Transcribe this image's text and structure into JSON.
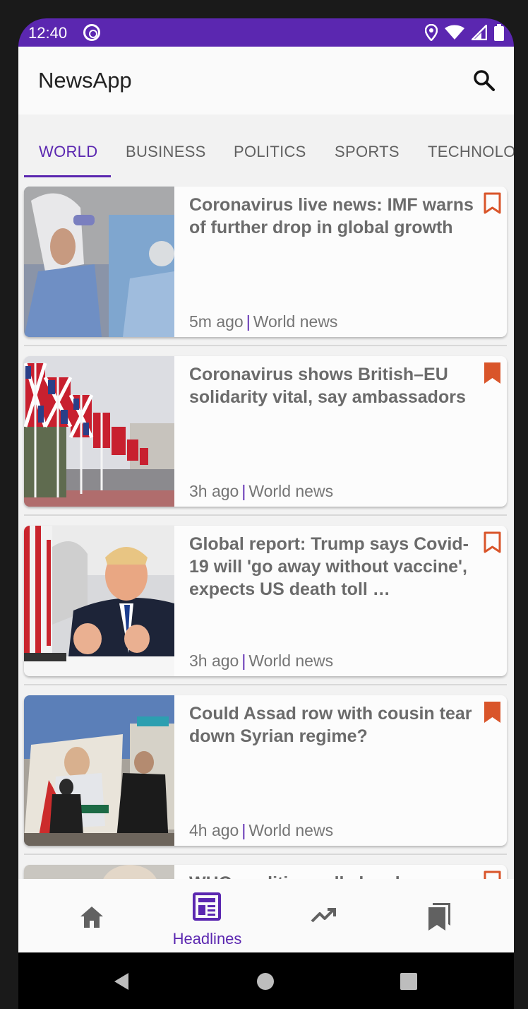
{
  "status_bar": {
    "time": "12:40"
  },
  "app_bar": {
    "title": "NewsApp"
  },
  "tabs": [
    {
      "label": "WORLD",
      "active": true
    },
    {
      "label": "BUSINESS",
      "active": false
    },
    {
      "label": "POLITICS",
      "active": false
    },
    {
      "label": "SPORTS",
      "active": false
    },
    {
      "label": "TECHNOLOGY",
      "active": false
    }
  ],
  "articles": [
    {
      "headline": "Coronavirus live news: IMF warns of further drop in global growth",
      "age": "5m ago",
      "section": "World news",
      "bookmarked": false
    },
    {
      "headline": "Coronavirus shows British–EU solidarity vital, say ambassadors",
      "age": "3h ago",
      "section": "World news",
      "bookmarked": true
    },
    {
      "headline": "Global report: Trump says Covid-19 will 'go away without vaccine', expects US death toll …",
      "age": "3h ago",
      "section": "World news",
      "bookmarked": false
    },
    {
      "headline": "Could Assad row with cousin tear down Syrian regime?",
      "age": "4h ago",
      "section": "World news",
      "bookmarked": true
    },
    {
      "headline": "WHO coalition calls head",
      "age": "",
      "section": "",
      "bookmarked": false
    }
  ],
  "meta_separator": "|",
  "bottom_nav": [
    {
      "icon": "home-icon",
      "label": ""
    },
    {
      "icon": "newspaper-icon",
      "label": "Headlines",
      "active": true
    },
    {
      "icon": "trending-icon",
      "label": ""
    },
    {
      "icon": "bookmarks-icon",
      "label": ""
    }
  ],
  "colors": {
    "accent": "#5b27b0",
    "bookmark": "#d9552a",
    "status_bar": "#5b27b0"
  }
}
